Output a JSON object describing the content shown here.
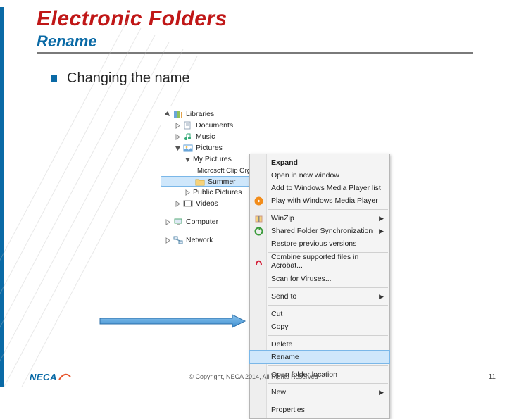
{
  "slide": {
    "title": "Electronic Folders",
    "subtitle": "Rename",
    "bullet": "Changing the name"
  },
  "tree": {
    "libraries": "Libraries",
    "documents": "Documents",
    "music": "Music",
    "pictures": "Pictures",
    "my_pictures": "My Pictures",
    "clip_organizer": "Microsoft Clip Organizer",
    "selected": "Summer",
    "public_pictures": "Public Pictures",
    "videos": "Videos",
    "computer": "Computer",
    "network": "Network"
  },
  "menu": {
    "expand": "Expand",
    "open_new_window": "Open in new window",
    "add_wmp": "Add to Windows Media Player list",
    "play_wmp": "Play with Windows Media Player",
    "winzip": "WinZip",
    "shared_sync": "Shared Folder Synchronization",
    "restore": "Restore previous versions",
    "acrobat": "Combine supported files in Acrobat...",
    "scan": "Scan for Viruses...",
    "send_to": "Send to",
    "cut": "Cut",
    "copy": "Copy",
    "delete": "Delete",
    "rename": "Rename",
    "open_location": "Open folder location",
    "new": "New",
    "properties": "Properties"
  },
  "footer": {
    "logo_text": "NECA",
    "copyright": "© Copyright, NECA 2014, All Rights Reserved",
    "page": "11"
  }
}
